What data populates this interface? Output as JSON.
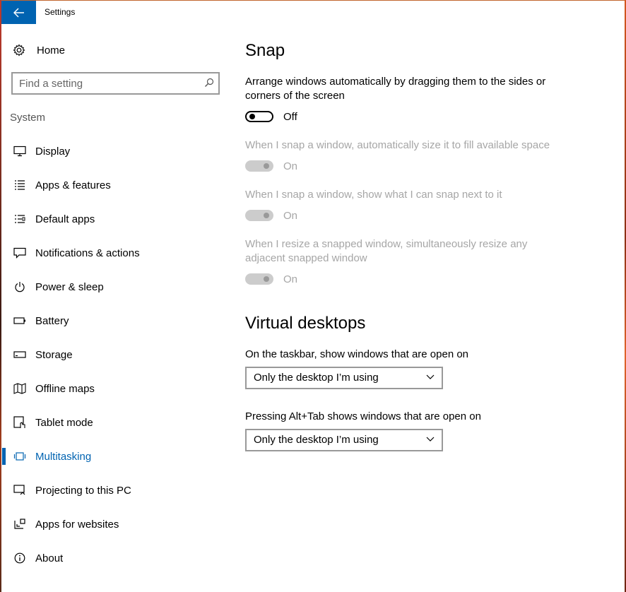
{
  "window": {
    "title": "Settings"
  },
  "sidebar": {
    "home_label": "Home",
    "search_placeholder": "Find a setting",
    "section_label": "System",
    "items": [
      {
        "label": "Display",
        "icon": "monitor-icon"
      },
      {
        "label": "Apps & features",
        "icon": "list-icon"
      },
      {
        "label": "Default apps",
        "icon": "default-apps-icon"
      },
      {
        "label": "Notifications & actions",
        "icon": "notification-icon"
      },
      {
        "label": "Power & sleep",
        "icon": "power-icon"
      },
      {
        "label": "Battery",
        "icon": "battery-icon"
      },
      {
        "label": "Storage",
        "icon": "storage-icon"
      },
      {
        "label": "Offline maps",
        "icon": "map-icon"
      },
      {
        "label": "Tablet mode",
        "icon": "tablet-icon"
      },
      {
        "label": "Multitasking",
        "icon": "multitasking-icon",
        "selected": true
      },
      {
        "label": "Projecting to this PC",
        "icon": "projecting-icon"
      },
      {
        "label": "Apps for websites",
        "icon": "apps-websites-icon"
      },
      {
        "label": "About",
        "icon": "info-icon"
      }
    ]
  },
  "snap": {
    "heading": "Snap",
    "main_setting": {
      "description": "Arrange windows automatically by dragging them to the sides or corners of the screen",
      "state": "Off"
    },
    "sub_settings": [
      {
        "description": "When I snap a window, automatically size it to fill available space",
        "state": "On",
        "enabled": false
      },
      {
        "description": "When I snap a window, show what I can snap next to it",
        "state": "On",
        "enabled": false
      },
      {
        "description": "When I resize a snapped window, simultaneously resize any adjacent snapped window",
        "state": "On",
        "enabled": false
      }
    ]
  },
  "virtual_desktops": {
    "heading": "Virtual desktops",
    "taskbar": {
      "label": "On the taskbar, show windows that are open on",
      "value": "Only the desktop I’m using"
    },
    "alttab": {
      "label": "Pressing Alt+Tab shows windows that are open on",
      "value": "Only the desktop I’m using"
    }
  },
  "colors": {
    "accent": "#0063b1",
    "disabled_text": "#a6a6a6",
    "disabled_toggle": "#cccccc"
  }
}
